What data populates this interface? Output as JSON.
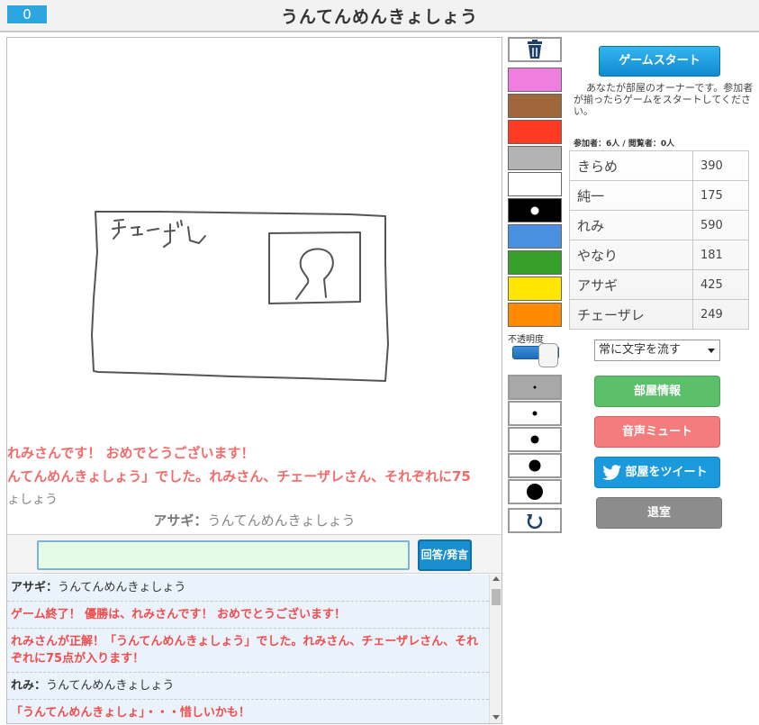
{
  "header": {
    "counter": "0",
    "title": "うんてんめんきょしょう"
  },
  "canvas": {
    "drawing_text": "チェーザレ",
    "overlay_lines": [
      "れみさんです！ おめでとうございます！",
      "んてんめんきょしょう」でした。れみさん、チェーザレさん、それぞれに75",
      "ょしょう"
    ],
    "overlay_bottom": {
      "name": "アサギ：",
      "text": "うんてんめんきょしょう"
    }
  },
  "answer": {
    "button_label": "回答/発言",
    "value": ""
  },
  "log": [
    {
      "name": "アサギ：",
      "text": "うんてんめんきょしょう",
      "red": false
    },
    {
      "name": "",
      "text": "ゲーム終了！ 優勝は、れみさんです！ おめでとうございます！",
      "red": true
    },
    {
      "name": "",
      "text": "れみさんが正解！「うんてんめんきょしょう」でした。れみさん、チェーザレさん、それぞれに75点が入ります！",
      "red": true
    },
    {
      "name": "れみ：",
      "text": "うんてんめんきょしょう",
      "red": false
    },
    {
      "name": "",
      "text": "「うんてんめんきょしょ」・・・惜しいかも！",
      "red": true
    }
  ],
  "tools": {
    "colors": [
      "#f07de0",
      "#a0673d",
      "#ff3b24",
      "#b3b3b3",
      "#ffffff",
      "#000000",
      "#4a90e0",
      "#37a02a",
      "#ffe600",
      "#ff8a00"
    ],
    "opacity_label": "不透明度",
    "opacity": 0.7,
    "brush_sizes": [
      "size-1",
      "size-2",
      "size-3",
      "size-4",
      "size-5"
    ],
    "icons": [
      "trash-icon",
      "undo-icon"
    ]
  },
  "side": {
    "start_button": "ゲームスタート",
    "owner_note": "あなたが部屋のオーナーです。参加者が揃ったらゲームをスタートしてください。",
    "counts": "参加者：6人 / 閲覧者：0人",
    "players": [
      {
        "name": "きらめ",
        "score": "390"
      },
      {
        "name": "純一",
        "score": "175"
      },
      {
        "name": "れみ",
        "score": "590"
      },
      {
        "name": "やなり",
        "score": "181"
      },
      {
        "name": "アサギ",
        "score": "425"
      },
      {
        "name": "チェーザレ",
        "score": "249"
      }
    ],
    "mode_select": "常に文字を流す",
    "room_info": "部屋情報",
    "mute": "音声ミュート",
    "tweet": "部屋をツイート",
    "exit": "退室"
  }
}
